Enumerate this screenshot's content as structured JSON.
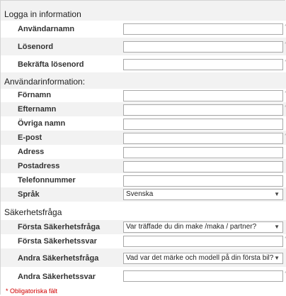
{
  "sections": {
    "login": "Logga in information",
    "user": "Användarinformation:",
    "security": "Säkerhetsfråga"
  },
  "labels": {
    "username": "Användarnamn",
    "password": "Lösenord",
    "confirm_password": "Bekräfta lösenord",
    "first_name": "Förnamn",
    "last_name": "Efternamn",
    "other_names": "Övriga namn",
    "email": "E-post",
    "address": "Adress",
    "postal_address": "Postadress",
    "phone": "Telefonnummer",
    "language": "Språk",
    "q1": "Första Säkerhetsfråga",
    "a1": "Första Säkerhetssvar",
    "q2": "Andra Säkerhetsfråga",
    "a2": "Andra Säkerhetssvar"
  },
  "values": {
    "username": "",
    "password": "",
    "confirm_password": "",
    "first_name": "",
    "last_name": "",
    "other_names": "",
    "email": "",
    "address": "",
    "postal_address": "",
    "phone": "",
    "a1": "",
    "a2": ""
  },
  "selects": {
    "language": "Svenska",
    "q1": "Var träffade du din make /maka / partner?",
    "q2": "Vad var det märke och modell på din första bil?"
  },
  "required_marker": "*",
  "required_note": "* Obligatoriska fält"
}
